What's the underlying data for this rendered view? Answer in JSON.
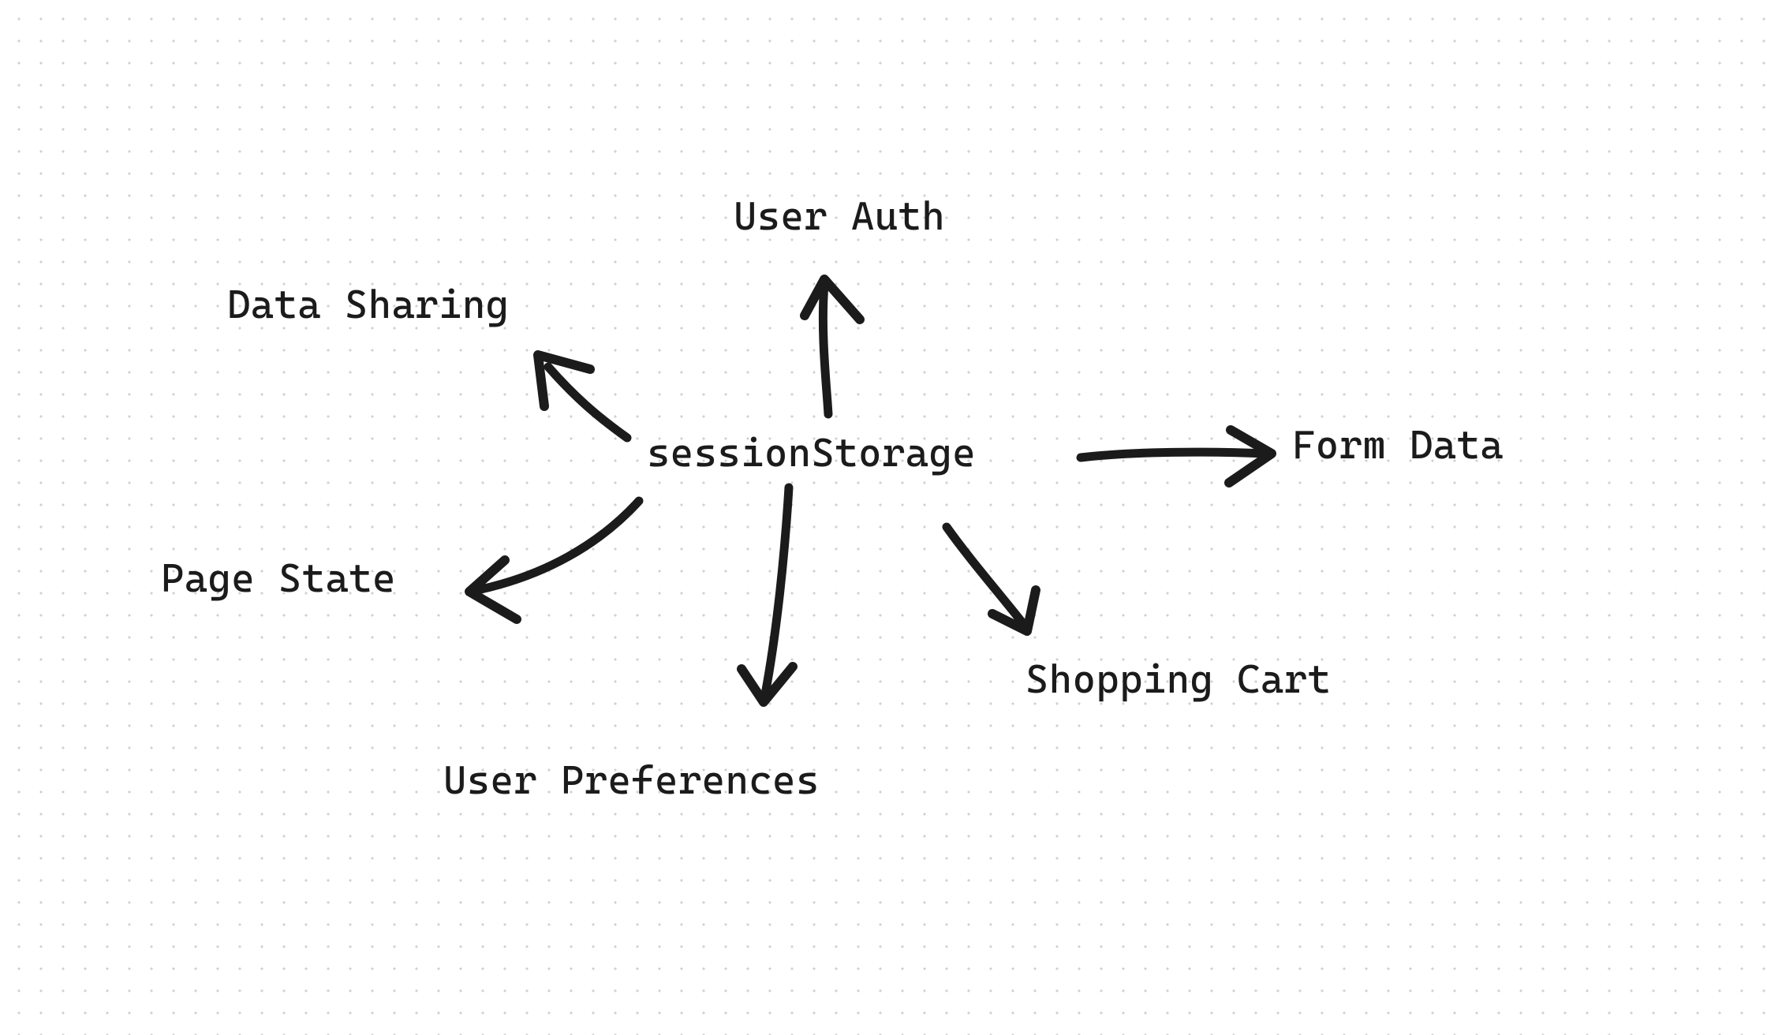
{
  "diagram": {
    "center": {
      "label": "sessionStorage"
    },
    "spokes": {
      "user_auth": {
        "label": "User Auth"
      },
      "data_sharing": {
        "label": "Data Sharing"
      },
      "form_data": {
        "label": "Form Data"
      },
      "page_state": {
        "label": "Page State"
      },
      "shopping_cart": {
        "label": "Shopping Cart"
      },
      "user_preferences": {
        "label": "User Preferences"
      }
    }
  }
}
